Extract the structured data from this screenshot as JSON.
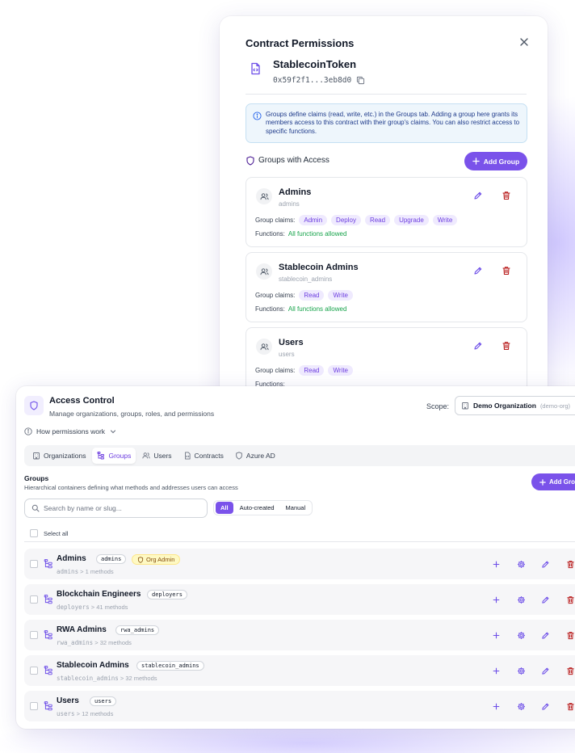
{
  "modal": {
    "title": "Contract Permissions",
    "contract_name": "StablecoinToken",
    "contract_address": "0x59f2f1...3eb8d0",
    "info_text": "Groups define claims (read, write, etc.) in the Groups tab. Adding a group here grants its members access to this contract with their group's claims. You can also restrict access to specific functions.",
    "section_label": "Groups with Access",
    "add_group_label": "Add Group",
    "claims_label": "Group claims:",
    "functions_label": "Functions:",
    "groups": [
      {
        "name": "Admins",
        "slug": "admins",
        "claims": [
          "Admin",
          "Deploy",
          "Read",
          "Upgrade",
          "Write"
        ],
        "functions": "All functions allowed"
      },
      {
        "name": "Stablecoin Admins",
        "slug": "stablecoin_admins",
        "claims": [
          "Read",
          "Write"
        ],
        "functions": "All functions allowed"
      },
      {
        "name": "Users",
        "slug": "users",
        "claims": [
          "Read",
          "Write"
        ],
        "functions": ""
      }
    ]
  },
  "access_control": {
    "title": "Access Control",
    "subtitle": "Manage organizations, groups, roles, and permissions",
    "scope_label": "Scope:",
    "scope_value": "Demo Organization",
    "scope_slug": "(demo-org)",
    "how_permissions": "How permissions work",
    "tabs": [
      {
        "label": "Organizations",
        "icon": "building-icon",
        "active": false
      },
      {
        "label": "Groups",
        "icon": "tree-icon",
        "active": true
      },
      {
        "label": "Users",
        "icon": "users-icon",
        "active": false
      },
      {
        "label": "Contracts",
        "icon": "contract-icon",
        "active": false
      },
      {
        "label": "Azure AD",
        "icon": "shield-icon",
        "active": false
      }
    ],
    "groups_title": "Groups",
    "groups_subtitle": "Hierarchical containers defining what methods and addresses users can access",
    "add_group_label": "Add Group",
    "search_placeholder": "Search by name or slug...",
    "filters": [
      "All",
      "Auto-created",
      "Manual"
    ],
    "active_filter": "All",
    "select_all": "Select all",
    "rows": [
      {
        "name": "Admins",
        "slug": "admins",
        "badge": "Org Admin",
        "meta_slug": "admins",
        "methods": "1 methods"
      },
      {
        "name": "Blockchain Engineers",
        "slug": "deployers",
        "badge": "",
        "meta_slug": "deployers",
        "methods": "41 methods"
      },
      {
        "name": "RWA Admins",
        "slug": "rwa_admins",
        "badge": "",
        "meta_slug": "rwa_admins",
        "methods": "32 methods"
      },
      {
        "name": "Stablecoin Admins",
        "slug": "stablecoin_admins",
        "badge": "",
        "meta_slug": "stablecoin_admins",
        "methods": "32 methods"
      },
      {
        "name": "Users",
        "slug": "users",
        "badge": "",
        "meta_slug": "users",
        "methods": "12 methods"
      }
    ]
  },
  "colors": {
    "accent": "#7a52ea",
    "success": "#16a34a",
    "danger": "#b91c1c",
    "info_bg": "#eef6fc",
    "badge_bg": "#fef9c3"
  }
}
